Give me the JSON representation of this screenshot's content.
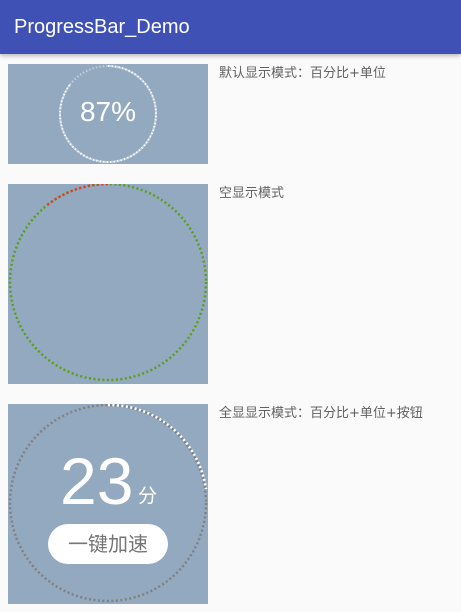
{
  "appbar": {
    "title": "ProgressBar_Demo",
    "color": "#3f51b5"
  },
  "panels": [
    {
      "caption": "默认显示模式：百分比+单位",
      "progress": 0.87,
      "percent_text": "87%"
    },
    {
      "caption": "空显示模式",
      "progress_color": "#e53935",
      "track_color": "#5a9e1a"
    },
    {
      "caption": "全显显示模式：百分比+单位+按钮",
      "value": "23",
      "unit": "分",
      "button_label": "一键加速",
      "progress": 0.23
    }
  ],
  "colors": {
    "panel_bg": "#93a9bf",
    "caption_text": "#616161"
  }
}
